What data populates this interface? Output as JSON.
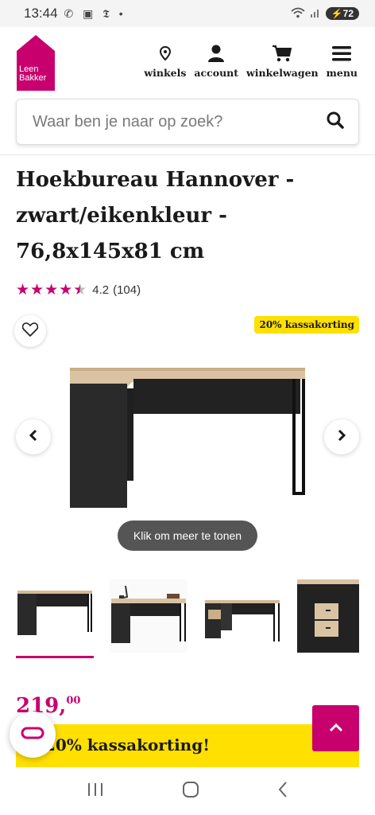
{
  "status_bar": {
    "time": "13:44",
    "battery": "72"
  },
  "brand": {
    "logo_line1": "Leen",
    "logo_line2": "Bakker",
    "color": "#c8006e"
  },
  "nav": {
    "items": [
      {
        "label": "winkels",
        "icon": "location-pin-icon"
      },
      {
        "label": "account",
        "icon": "user-icon"
      },
      {
        "label": "winkelwagen",
        "icon": "cart-icon"
      },
      {
        "label": "menu",
        "icon": "hamburger-icon"
      }
    ]
  },
  "search": {
    "placeholder": "Waar ben je naar op zoek?"
  },
  "product": {
    "title": "Hoekbureau Hannover - zwart/eikenkleur - 76,8x145x81 cm",
    "rating": {
      "score": "4.2",
      "count": "(104)",
      "stars_filled": 4.2,
      "stars_max": 5
    },
    "badge": "20% kassakorting",
    "more_label": "Klik om meer te tonen",
    "price_whole": "219,",
    "price_cents": "00",
    "promo_banner": "20% kassakorting!"
  },
  "colors": {
    "accent": "#c8006e",
    "promo_yellow": "#ffe000"
  }
}
